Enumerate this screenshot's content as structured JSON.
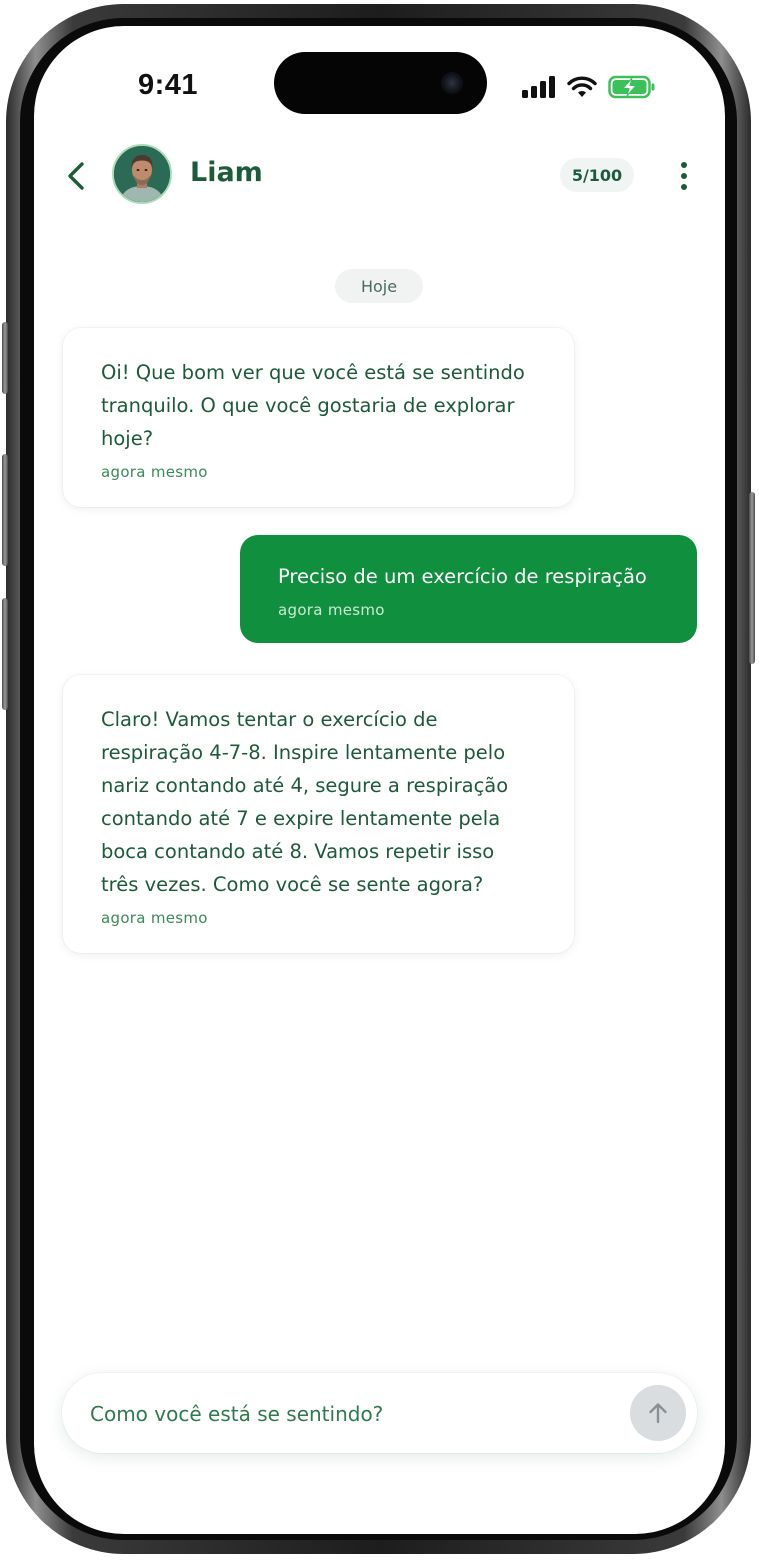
{
  "status_bar": {
    "time": "9:41",
    "icons": [
      "cellular-signal-icon",
      "wifi-icon",
      "battery-charging-icon"
    ]
  },
  "header": {
    "back_icon": "chevron-left-icon",
    "contact_name": "Liam",
    "message_counter": "5/100",
    "more_icon": "more-vertical-icon"
  },
  "conversation": {
    "date_label": "Hoje",
    "messages": [
      {
        "direction": "incoming",
        "text": "Oi! Que bom ver que você está se sentindo tranquilo. O que você gostaria de explorar hoje?",
        "time": "agora mesmo"
      },
      {
        "direction": "outgoing",
        "text": "Preciso de um exercício de respiração",
        "time": "agora mesmo"
      },
      {
        "direction": "incoming",
        "text": "Claro! Vamos tentar o exercício de respiração 4-7-8. Inspire lentamente pelo nariz contando até 4, segure a respiração contando até 7 e expire lentamente pela boca contando até 8. Vamos repetir isso três vezes. Como você se sente agora?",
        "time": "agora mesmo"
      }
    ]
  },
  "composer": {
    "placeholder": "Como você está se sentindo?",
    "value": "",
    "send_icon": "arrow-up-icon"
  },
  "colors": {
    "brand_green": "#108f3e",
    "text_green": "#1d5c3a",
    "send_disabled": "#d9dde0"
  }
}
